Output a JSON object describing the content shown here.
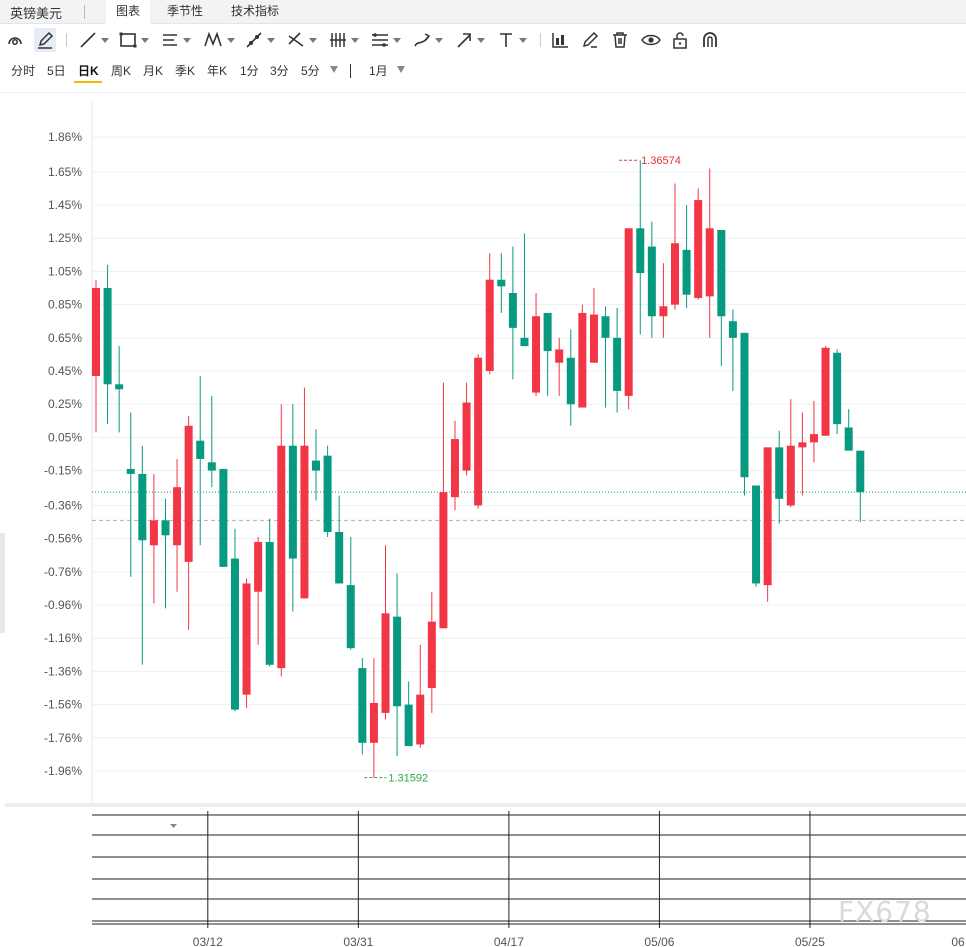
{
  "tabbar": {
    "title": "英镑美元",
    "tabs": [
      {
        "label": "图表",
        "active": true
      },
      {
        "label": "季节性",
        "active": false
      },
      {
        "label": "技术指标",
        "active": false
      }
    ]
  },
  "toolbar": {
    "tools": [
      {
        "icon": "magnet-icon"
      },
      {
        "icon": "pencil-draw-icon",
        "active": true
      },
      {
        "icon": "trend-line-icon",
        "has_menu": true
      },
      {
        "icon": "rectangle-icon",
        "has_menu": true
      },
      {
        "icon": "parallel-lines-icon",
        "has_menu": true
      },
      {
        "icon": "pattern-icon",
        "has_menu": true
      },
      {
        "icon": "ray-icon",
        "has_menu": true
      },
      {
        "icon": "cross-lines-icon",
        "has_menu": true
      },
      {
        "icon": "fibonacci-icon",
        "has_menu": true
      },
      {
        "icon": "gann-icon",
        "has_menu": true
      },
      {
        "icon": "brush-icon",
        "has_menu": true
      },
      {
        "icon": "arrow-icon",
        "has_menu": true
      },
      {
        "icon": "text-icon",
        "has_menu": true
      },
      {
        "icon": "indicator-bars-icon"
      },
      {
        "icon": "edit-icon"
      },
      {
        "icon": "trash-icon"
      },
      {
        "icon": "eye-icon"
      },
      {
        "icon": "unlock-icon"
      },
      {
        "icon": "magnet-snap-icon"
      }
    ]
  },
  "periods": {
    "items": [
      "分时",
      "5日",
      "日K",
      "周K",
      "月K",
      "季K",
      "年K",
      "1分",
      "3分",
      "5分"
    ],
    "active": "日K",
    "range_label": "1月"
  },
  "colors": {
    "up": "#f23645",
    "down": "#089981",
    "grid": "#eef0f3",
    "axis_text": "#555555",
    "high_label": "#e0303a",
    "low_label": "#2ea84a",
    "last_price_line": "#089981"
  },
  "chart_data": {
    "type": "candlestick",
    "y_unit": "%",
    "y_ticks": [
      "1.86%",
      "1.65%",
      "1.45%",
      "1.25%",
      "1.05%",
      "0.85%",
      "0.65%",
      "0.45%",
      "0.25%",
      "0.05%",
      "-0.15%",
      "-0.36%",
      "-0.56%",
      "-0.76%",
      "-0.96%",
      "-1.16%",
      "-1.36%",
      "-1.56%",
      "-1.76%",
      "-1.96%"
    ],
    "y_tick_values": [
      1.86,
      1.65,
      1.45,
      1.25,
      1.05,
      0.85,
      0.65,
      0.45,
      0.25,
      0.05,
      -0.15,
      -0.36,
      -0.56,
      -0.76,
      -0.96,
      -1.16,
      -1.36,
      -1.56,
      -1.76,
      -1.96
    ],
    "ylim": [
      -2.15,
      2.0
    ],
    "x_ticks": [
      {
        "label": "03/12",
        "index": 10
      },
      {
        "label": "03/31",
        "index": 23
      },
      {
        "label": "04/17",
        "index": 36
      },
      {
        "label": "05/06",
        "index": 49
      },
      {
        "label": "05/25",
        "index": 62
      },
      {
        "label": "06",
        "index": 74
      }
    ],
    "high_annotation": {
      "text": "1.36574",
      "index": 45,
      "value": 1.72
    },
    "low_annotation": {
      "text": "1.31592",
      "index": 23,
      "value": -2.0
    },
    "last_price_line_value": -0.28,
    "prev_close_line_value": -0.45,
    "candles": [
      {
        "o": 0.42,
        "h": 1.0,
        "l": 0.08,
        "c": 0.95
      },
      {
        "o": 0.95,
        "h": 1.09,
        "l": 0.13,
        "c": 0.37
      },
      {
        "o": 0.37,
        "h": 0.6,
        "l": 0.08,
        "c": 0.34
      },
      {
        "o": -0.14,
        "h": 0.2,
        "l": -0.79,
        "c": -0.17
      },
      {
        "o": -0.17,
        "h": 0.0,
        "l": -1.32,
        "c": -0.57
      },
      {
        "o": -0.6,
        "h": -0.17,
        "l": -0.95,
        "c": -0.45
      },
      {
        "o": -0.45,
        "h": -0.32,
        "l": -0.98,
        "c": -0.54
      },
      {
        "o": -0.6,
        "h": -0.08,
        "l": -0.88,
        "c": -0.25
      },
      {
        "o": -0.7,
        "h": 0.18,
        "l": -1.11,
        "c": 0.12
      },
      {
        "o": 0.03,
        "h": 0.42,
        "l": -0.6,
        "c": -0.08
      },
      {
        "o": -0.1,
        "h": 0.3,
        "l": -0.25,
        "c": -0.15
      },
      {
        "o": -0.14,
        "h": -0.22,
        "l": -0.73,
        "c": -0.73
      },
      {
        "o": -0.68,
        "h": -0.5,
        "l": -1.6,
        "c": -1.59
      },
      {
        "o": -1.5,
        "h": -0.8,
        "l": -1.58,
        "c": -0.83
      },
      {
        "o": -0.88,
        "h": -0.55,
        "l": -1.2,
        "c": -0.58
      },
      {
        "o": -0.58,
        "h": -0.44,
        "l": -1.33,
        "c": -1.32
      },
      {
        "o": -1.34,
        "h": 0.25,
        "l": -1.39,
        "c": 0.0
      },
      {
        "o": 0.0,
        "h": 0.25,
        "l": -1.0,
        "c": -0.68
      },
      {
        "o": -0.92,
        "h": 0.35,
        "l": -0.92,
        "c": 0.0
      },
      {
        "o": -0.09,
        "h": 0.1,
        "l": -0.33,
        "c": -0.15
      },
      {
        "o": -0.06,
        "h": 0.0,
        "l": -0.55,
        "c": -0.52
      },
      {
        "o": -0.52,
        "h": -0.3,
        "l": -0.82,
        "c": -0.83
      },
      {
        "o": -0.84,
        "h": -0.55,
        "l": -1.23,
        "c": -1.22
      },
      {
        "o": -1.34,
        "h": -1.28,
        "l": -1.86,
        "c": -1.79
      },
      {
        "o": -1.79,
        "h": -1.28,
        "l": -2.0,
        "c": -1.55
      },
      {
        "o": -1.61,
        "h": -0.6,
        "l": -1.65,
        "c": -1.01
      },
      {
        "o": -1.03,
        "h": -0.77,
        "l": -1.87,
        "c": -1.57
      },
      {
        "o": -1.56,
        "h": -1.42,
        "l": -1.81,
        "c": -1.81
      },
      {
        "o": -1.8,
        "h": -1.2,
        "l": -1.82,
        "c": -1.5
      },
      {
        "o": -1.46,
        "h": -0.88,
        "l": -1.61,
        "c": -1.06
      },
      {
        "o": -1.1,
        "h": 0.38,
        "l": -1.1,
        "c": -0.28
      },
      {
        "o": -0.31,
        "h": 0.15,
        "l": -0.39,
        "c": 0.04
      },
      {
        "o": -0.15,
        "h": 0.38,
        "l": -0.18,
        "c": 0.26
      },
      {
        "o": -0.36,
        "h": 0.55,
        "l": -0.38,
        "c": 0.53
      },
      {
        "o": 0.45,
        "h": 1.16,
        "l": 0.43,
        "c": 1.0
      },
      {
        "o": 1.0,
        "h": 1.16,
        "l": 0.8,
        "c": 0.96
      },
      {
        "o": 0.92,
        "h": 1.2,
        "l": 0.4,
        "c": 0.71
      },
      {
        "o": 0.65,
        "h": 1.28,
        "l": 0.6,
        "c": 0.6
      },
      {
        "o": 0.32,
        "h": 0.92,
        "l": 0.3,
        "c": 0.78
      },
      {
        "o": 0.8,
        "h": 0.79,
        "l": 0.3,
        "c": 0.57
      },
      {
        "o": 0.5,
        "h": 0.65,
        "l": 0.3,
        "c": 0.58
      },
      {
        "o": 0.53,
        "h": 0.7,
        "l": 0.12,
        "c": 0.25
      },
      {
        "o": 0.23,
        "h": 0.85,
        "l": 0.23,
        "c": 0.8
      },
      {
        "o": 0.5,
        "h": 0.95,
        "l": 0.5,
        "c": 0.79
      },
      {
        "o": 0.78,
        "h": 0.84,
        "l": 0.23,
        "c": 0.65
      },
      {
        "o": 0.65,
        "h": 0.83,
        "l": 0.2,
        "c": 0.33
      },
      {
        "o": 0.3,
        "h": 1.27,
        "l": 0.22,
        "c": 1.31
      },
      {
        "o": 1.31,
        "h": 1.72,
        "l": 0.67,
        "c": 1.04
      },
      {
        "o": 1.2,
        "h": 1.35,
        "l": 0.65,
        "c": 0.78
      },
      {
        "o": 0.78,
        "h": 1.1,
        "l": 0.65,
        "c": 0.84
      },
      {
        "o": 0.85,
        "h": 1.58,
        "l": 0.82,
        "c": 1.22
      },
      {
        "o": 1.18,
        "h": 1.45,
        "l": 0.83,
        "c": 0.91
      },
      {
        "o": 0.89,
        "h": 1.55,
        "l": 0.88,
        "c": 1.48
      },
      {
        "o": 0.9,
        "h": 1.67,
        "l": 0.65,
        "c": 1.31
      },
      {
        "o": 1.3,
        "h": 1.3,
        "l": 0.48,
        "c": 0.78
      },
      {
        "o": 0.75,
        "h": 0.82,
        "l": 0.33,
        "c": 0.65
      },
      {
        "o": 0.68,
        "h": 0.68,
        "l": -0.3,
        "c": -0.19
      },
      {
        "o": -0.24,
        "h": -0.24,
        "l": -0.85,
        "c": -0.83
      },
      {
        "o": -0.84,
        "h": -0.08,
        "l": -0.94,
        "c": -0.01
      },
      {
        "o": -0.01,
        "h": 0.09,
        "l": -0.47,
        "c": -0.32
      },
      {
        "o": -0.36,
        "h": 0.28,
        "l": -0.37,
        "c": 0.0
      },
      {
        "o": -0.01,
        "h": 0.2,
        "l": -0.3,
        "c": 0.02
      },
      {
        "o": 0.02,
        "h": 0.27,
        "l": -0.1,
        "c": 0.07
      },
      {
        "o": 0.06,
        "h": 0.6,
        "l": 0.06,
        "c": 0.59
      },
      {
        "o": 0.56,
        "h": 0.58,
        "l": 0.07,
        "c": 0.13
      },
      {
        "o": 0.11,
        "h": 0.22,
        "l": -0.02,
        "c": -0.03
      },
      {
        "o": -0.03,
        "h": -0.03,
        "l": -0.46,
        "c": -0.28
      }
    ]
  },
  "watermark": "FX678"
}
